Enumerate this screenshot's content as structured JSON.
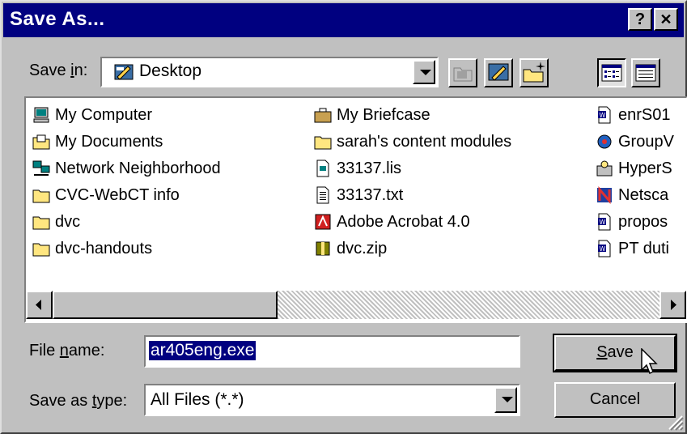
{
  "window": {
    "title": "Save As...",
    "help_label": "?",
    "close_label": "✕"
  },
  "save_in": {
    "label_pre": "Save ",
    "label_accel": "i",
    "label_post": "n:",
    "value": "Desktop"
  },
  "toolbar": [
    {
      "name": "up-one-level-button",
      "icon": "up-folder-icon"
    },
    {
      "name": "desktop-button",
      "icon": "desktop-icon"
    },
    {
      "name": "new-folder-button",
      "icon": "new-folder-icon"
    },
    {
      "name": "list-view-button",
      "icon": "list-view-icon",
      "pressed": true
    },
    {
      "name": "details-view-button",
      "icon": "details-view-icon"
    }
  ],
  "files": {
    "col1": [
      {
        "name": "My Computer",
        "icon": "computer-icon"
      },
      {
        "name": "My Documents",
        "icon": "documents-folder-icon"
      },
      {
        "name": "Network Neighborhood",
        "icon": "network-icon"
      },
      {
        "name": "CVC-WebCT info",
        "icon": "folder-icon"
      },
      {
        "name": "dvc",
        "icon": "folder-icon"
      },
      {
        "name": "dvc-handouts",
        "icon": "folder-icon"
      }
    ],
    "col2": [
      {
        "name": "My Briefcase",
        "icon": "briefcase-icon"
      },
      {
        "name": "sarah's content modules",
        "icon": "folder-icon"
      },
      {
        "name": "33137.lis",
        "icon": "file-icon"
      },
      {
        "name": "33137.txt",
        "icon": "text-file-icon"
      },
      {
        "name": "Adobe Acrobat 4.0",
        "icon": "acrobat-icon"
      },
      {
        "name": "dvc.zip",
        "icon": "zip-file-icon"
      }
    ],
    "col3": [
      {
        "name": "enrS01",
        "icon": "word-doc-icon"
      },
      {
        "name": "GroupV",
        "icon": "shortcut-icon"
      },
      {
        "name": "HyperS",
        "icon": "shortcut-icon"
      },
      {
        "name": "Netsca",
        "icon": "netscape-icon"
      },
      {
        "name": "propos",
        "icon": "word-doc-icon"
      },
      {
        "name": "PT duti",
        "icon": "word-doc-icon"
      }
    ]
  },
  "file_name": {
    "label_pre": "File ",
    "label_accel": "n",
    "label_post": "ame:",
    "value": "ar405eng.exe"
  },
  "save_type": {
    "label_pre": "Save as ",
    "label_accel": "t",
    "label_post": "ype:",
    "value": "All Files (*.*)"
  },
  "buttons": {
    "save_accel": "S",
    "save_rest": "ave",
    "cancel": "Cancel"
  },
  "colors": {
    "titlebar": "#000080",
    "face": "#c0c0c0",
    "selection": "#000080"
  }
}
